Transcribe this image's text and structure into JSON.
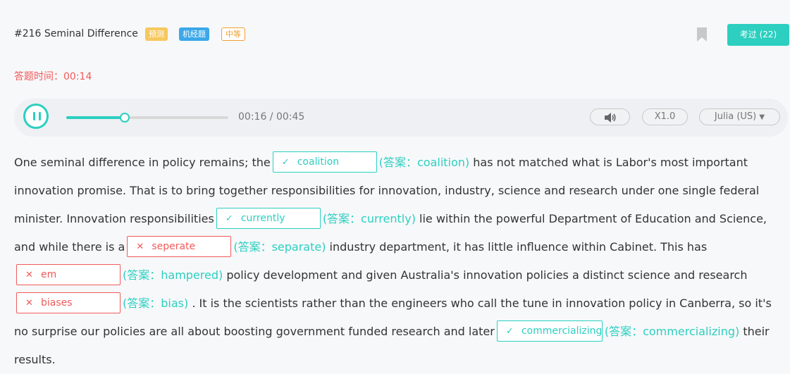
{
  "header": {
    "title": "#216 Seminal Difference",
    "tags": {
      "predict": "预测",
      "jijing": "机经题",
      "difficulty": "中等"
    },
    "exam_button": "考过 (22)"
  },
  "timer": {
    "label": "答题时间：",
    "value": "00:14"
  },
  "player": {
    "progress_fraction": 0.36,
    "time": "00:16 / 00:45",
    "speed": "X1.0",
    "voice": "Julia (US)"
  },
  "passage": {
    "t1": "One seminal difference in policy remains; the",
    "b1": {
      "mark": "✓",
      "value": "coalition",
      "answer": "(答案：coalition)"
    },
    "t2": " has not matched what is Labor's most important innovation promise. That is to bring together responsibilities for innovation, industry, science and research under one single federal minister. Innovation responsibilities",
    "b2": {
      "mark": "✓",
      "value": "currently",
      "answer": "(答案：currently)"
    },
    "t3": " lie within the powerful Department of Education and Science, and while there is a",
    "b3": {
      "mark": "✕",
      "value": "seperate",
      "answer": "(答案：separate)"
    },
    "t4": " industry department, it has little influence within Cabinet. This has",
    "b4": {
      "mark": "✕",
      "value": "em",
      "answer": "(答案：hampered)"
    },
    "t5": " policy development and given Australia's innovation policies a distinct science and research",
    "b5": {
      "mark": "✕",
      "value": "biases",
      "answer": "(答案：bias)"
    },
    "t6": " . It is the scientists rather than the engineers who call the tune in innovation policy in Canberra, so it's no surprise our policies are all about boosting government funded research and later",
    "b6": {
      "mark": "✓",
      "value": "commercializing",
      "answer": "(答案：commercializing)"
    },
    "t7": " their results."
  },
  "colors": {
    "accent": "#2ccfc0",
    "error": "#f25a5a",
    "tag_predict": "#f6c85f",
    "tag_jijing": "#3ba8e8",
    "tag_medium": "#f0a030"
  }
}
